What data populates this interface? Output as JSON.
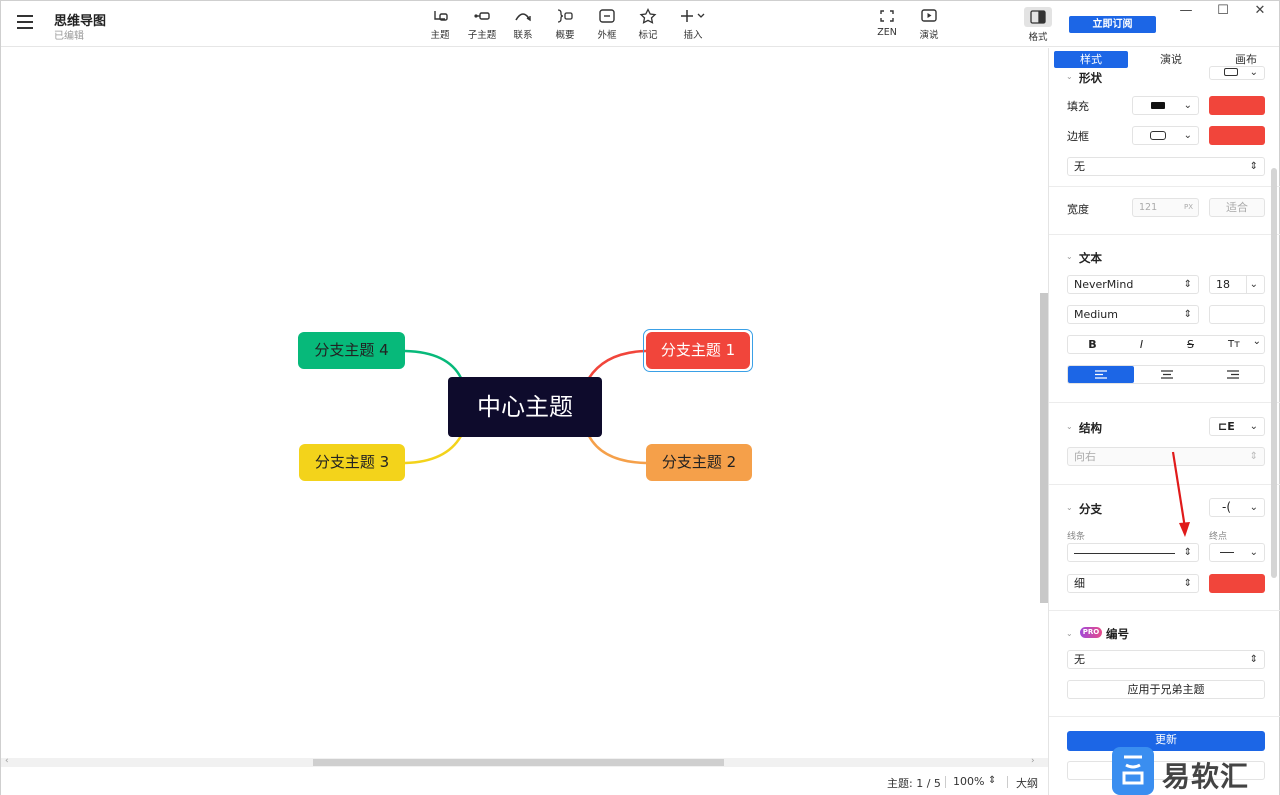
{
  "window": {
    "title": "思维导图",
    "status": "已编辑",
    "buttons": {
      "minimize": "—",
      "maximize": "☐",
      "close": "✕"
    }
  },
  "toolbar": {
    "items": [
      {
        "label": "主题",
        "icon": "topic-icon"
      },
      {
        "label": "子主题",
        "icon": "subtopic-icon"
      },
      {
        "label": "联系",
        "icon": "relationship-icon"
      },
      {
        "label": "概要",
        "icon": "summary-icon"
      },
      {
        "label": "外框",
        "icon": "boundary-icon"
      },
      {
        "label": "标记",
        "icon": "star-icon"
      },
      {
        "label": "插入",
        "icon": "plus-icon"
      }
    ],
    "zen_label": "ZEN",
    "present_label": "演说",
    "format_label": "格式",
    "subscribe_label": "立即订阅"
  },
  "mindmap": {
    "central": "中心主题",
    "branches": [
      {
        "label": "分支主题 1",
        "color": "#f1453b"
      },
      {
        "label": "分支主题 2",
        "color": "#f5a04a"
      },
      {
        "label": "分支主题 3",
        "color": "#f3d31b"
      },
      {
        "label": "分支主题 4",
        "color": "#07b97a"
      }
    ]
  },
  "statusbar": {
    "topic_count": "主题: 1 / 5",
    "zoom": "100%",
    "outline": "大纲"
  },
  "panel": {
    "tabs": [
      "样式",
      "演说",
      "画布"
    ],
    "shape": {
      "title": "形状",
      "fill_label": "填充",
      "border_label": "边框",
      "border_style": "无",
      "width_label": "宽度",
      "width_value": "121",
      "width_unit": "PX",
      "fit_label": "适合",
      "color": "#f1453b"
    },
    "text": {
      "title": "文本",
      "font": "NeverMind",
      "size": "18",
      "weight": "Medium",
      "bold": "B",
      "italic": "I",
      "strike": "S",
      "case": "Tт"
    },
    "structure": {
      "title": "结构",
      "value": "向右"
    },
    "branch": {
      "title": "分支",
      "line_label": "线条",
      "end_label": "终点",
      "thickness": "细",
      "color": "#f1453b"
    },
    "numbering": {
      "pro": "PRO",
      "title": "编号",
      "value": "无",
      "apply_label": "应用于兄弟主题"
    },
    "update_label": "更新"
  },
  "watermark": {
    "text": "易软汇"
  }
}
